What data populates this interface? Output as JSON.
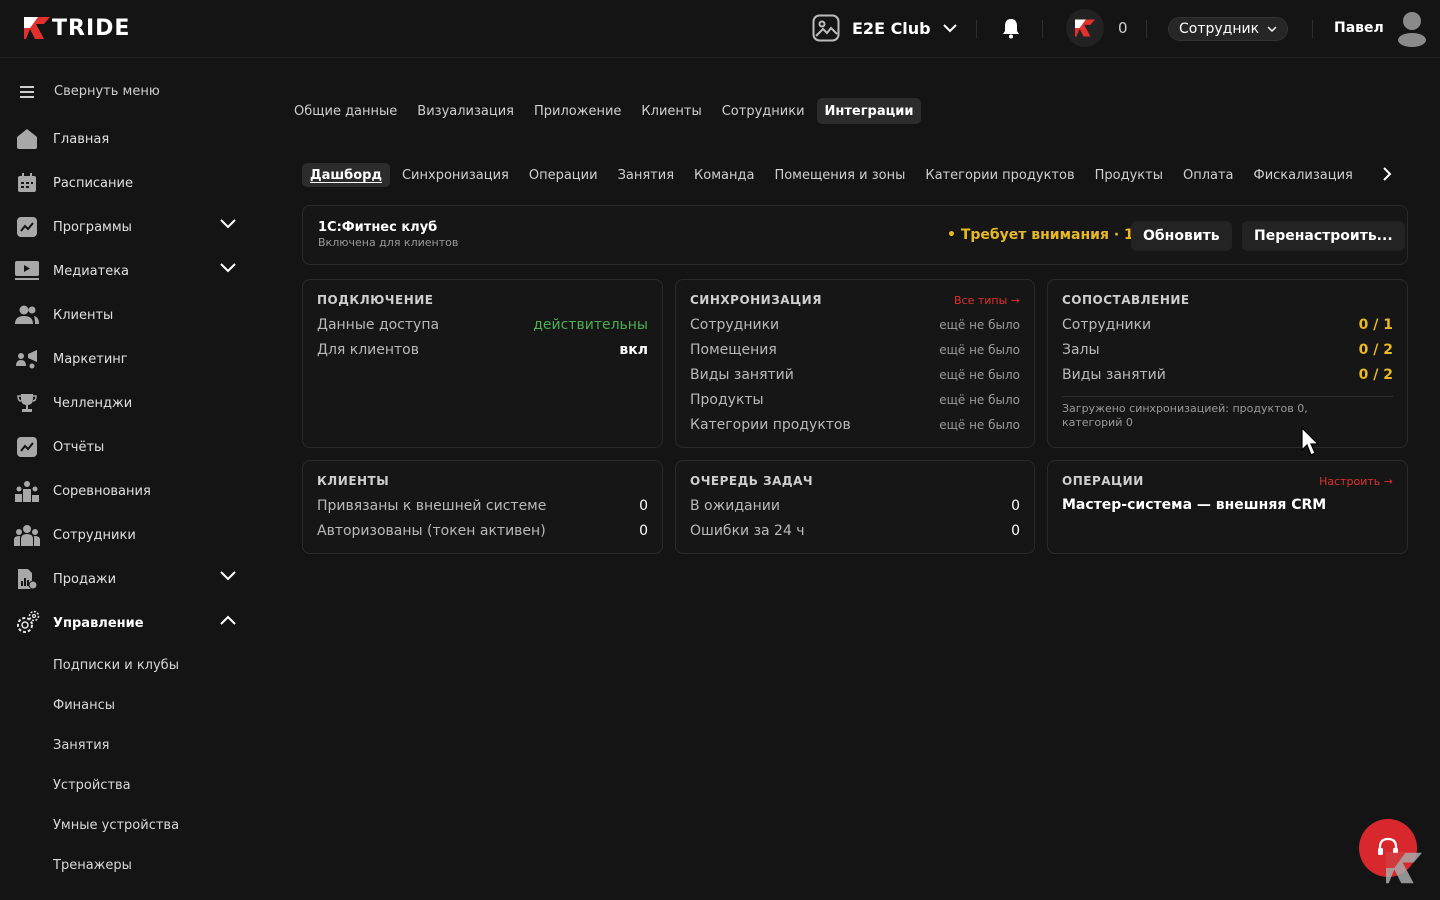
{
  "header": {
    "logo_text": "TRIDE",
    "club_name": "E2E Club",
    "points": "0",
    "role": "Сотрудник",
    "user_name": "Павел"
  },
  "sidebar": {
    "collapse_label": "Свернуть меню",
    "items": [
      {
        "label": "Главная",
        "icon": "home-icon"
      },
      {
        "label": "Расписание",
        "icon": "calendar-icon"
      },
      {
        "label": "Программы",
        "icon": "chart-icon"
      },
      {
        "label": "Медиатека",
        "icon": "media-icon"
      },
      {
        "label": "Клиенты",
        "icon": "clients-icon"
      },
      {
        "label": "Маркетинг",
        "icon": "marketing-icon"
      },
      {
        "label": "Челленджи",
        "icon": "trophy-icon"
      },
      {
        "label": "Отчёты",
        "icon": "reports-icon"
      },
      {
        "label": "Соревнования",
        "icon": "competitions-icon"
      },
      {
        "label": "Сотрудники",
        "icon": "staff-icon"
      },
      {
        "label": "Продажи",
        "icon": "sales-icon"
      },
      {
        "label": "Управление",
        "icon": "gear-icon"
      }
    ],
    "subitems": [
      "Подписки и клубы",
      "Финансы",
      "Занятия",
      "Устройства",
      "Умные устройства",
      "Тренажеры"
    ]
  },
  "tabs_main": [
    "Общие данные",
    "Визуализация",
    "Приложение",
    "Клиенты",
    "Сотрудники",
    "Интеграции"
  ],
  "tabs_sub": [
    "Дашборд",
    "Синхронизация",
    "Операции",
    "Занятия",
    "Команда",
    "Помещения и зоны",
    "Категории продуктов",
    "Продукты",
    "Оплата",
    "Фискализация"
  ],
  "integration": {
    "title": "1С:Фитнес клуб",
    "subtitle": "Включена для клиентов",
    "status": "• Требует внимания · 1",
    "refresh_label": "Обновить",
    "reconfigure_label": "Перенастроить..."
  },
  "connection": {
    "title": "ПОДКЛЮЧЕНИЕ",
    "rows": [
      {
        "label": "Данные доступа",
        "value": "действительны"
      },
      {
        "label": "Для клиентов",
        "value": "вкл"
      }
    ]
  },
  "sync": {
    "title": "СИНХРОНИЗАЦИЯ",
    "link": "Все типы →",
    "rows": [
      {
        "label": "Сотрудники",
        "value": "ещё не было"
      },
      {
        "label": "Помещения",
        "value": "ещё не было"
      },
      {
        "label": "Виды занятий",
        "value": "ещё не было"
      },
      {
        "label": "Продукты",
        "value": "ещё не было"
      },
      {
        "label": "Категории продуктов",
        "value": "ещё не было"
      }
    ]
  },
  "mapping": {
    "title": "СОПОСТАВЛЕНИЕ",
    "rows": [
      {
        "label": "Сотрудники",
        "value": "0 / 1"
      },
      {
        "label": "Залы",
        "value": "0 / 2"
      },
      {
        "label": "Виды занятий",
        "value": "0 / 2"
      }
    ],
    "note": "Загружено синхронизацией: продуктов 0, категорий 0"
  },
  "clients": {
    "title": "КЛИЕНТЫ",
    "rows": [
      {
        "label": "Привязаны к внешней системе",
        "value": "0"
      },
      {
        "label": "Авторизованы (токен активен)",
        "value": "0"
      }
    ]
  },
  "queue": {
    "title": "ОЧЕРЕДЬ ЗАДАЧ",
    "rows": [
      {
        "label": "В ожидании",
        "value": "0"
      },
      {
        "label": "Ошибки за 24 ч",
        "value": "0"
      }
    ]
  },
  "operations": {
    "title": "ОПЕРАЦИИ",
    "link": "Настроить →",
    "master": "Мастер-система — внешняя CRM"
  },
  "colors": {
    "background": "#141414",
    "accent_red": "#d8282d",
    "warning_yellow": "#e8b923",
    "success_green": "#4caf50"
  }
}
